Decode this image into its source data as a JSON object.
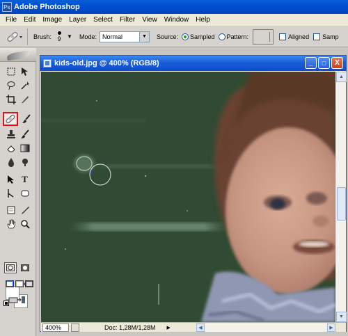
{
  "app": {
    "title": "Adobe Photoshop",
    "logo_text": "Ps"
  },
  "menubar": {
    "items": [
      "File",
      "Edit",
      "Image",
      "Layer",
      "Select",
      "Filter",
      "View",
      "Window",
      "Help"
    ]
  },
  "options": {
    "brush_label": "Brush:",
    "brush_size": "9",
    "mode_label": "Mode:",
    "mode_value": "Normal",
    "source_label": "Source:",
    "sampled_label": "Sampled",
    "pattern_label": "Pattern:",
    "aligned_label": "Aligned",
    "sample_label": "Samp",
    "source_selected": "Sampled"
  },
  "toolbox": {
    "selected_tool": "healing-brush",
    "highlight_color": "#e01010"
  },
  "document": {
    "title": "kids-old.jpg @ 400% (RGB/8)",
    "zoom": "400%",
    "doc_info": "Doc: 1,28M/1,28M",
    "minimize": "_",
    "maximize": "□",
    "close": "X"
  },
  "colors": {
    "title_bar": "#0f4ccd",
    "canvas_green": "#344d36",
    "selection_box": "#e01010"
  }
}
